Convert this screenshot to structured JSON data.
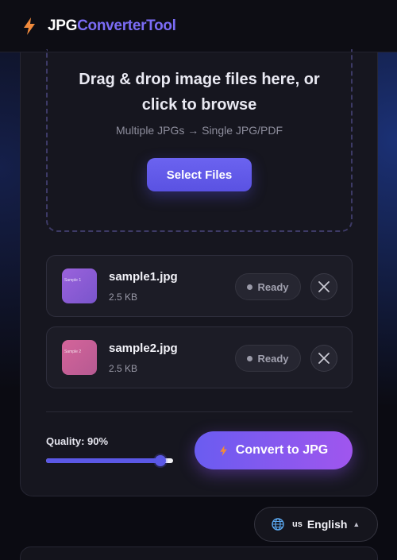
{
  "header": {
    "logo_part1": "JPG",
    "logo_part2": "ConverterTool",
    "icon": "bolt-icon",
    "accent_color": "#7b6cf6"
  },
  "dropzone": {
    "title": "Drag & drop image files here, or click to browse",
    "subtitle": "Multiple JPGs → Single JPG/PDF",
    "button_label": "Select Files"
  },
  "files": [
    {
      "name": "sample1.jpg",
      "size": "2.5 KB",
      "status": "Ready",
      "thumb_label": "Sample 1",
      "thumb_color": "#8a5cd8"
    },
    {
      "name": "sample2.jpg",
      "size": "2.5 KB",
      "status": "Ready",
      "thumb_label": "Sample 2",
      "thumb_color": "#c85a96"
    }
  ],
  "quality": {
    "label": "Quality: 90%",
    "value": 90
  },
  "convert": {
    "label": "Convert to JPG"
  },
  "language": {
    "code": "us",
    "label": "English",
    "caret": "▲"
  }
}
